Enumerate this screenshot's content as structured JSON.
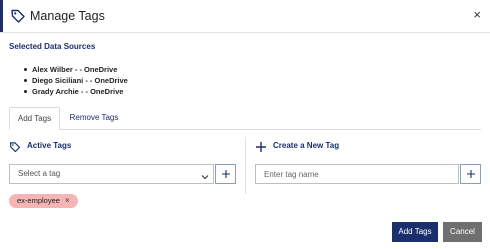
{
  "header": {
    "title": "Manage Tags",
    "close_label": "×"
  },
  "selected_sources": {
    "title": "Selected Data Sources",
    "items": [
      "Alex Wilber - - OneDrive",
      "Diego Siciliani - - OneDrive",
      "Grady Archie - - OneDrive"
    ]
  },
  "tabs": [
    {
      "label": "Add Tags",
      "active": true
    },
    {
      "label": "Remove Tags",
      "active": false
    }
  ],
  "active_tags": {
    "title": "Active Tags",
    "select_value": "Select a tag",
    "chips": [
      {
        "label": "ex-employee",
        "remove_label": "×"
      }
    ]
  },
  "new_tag": {
    "title": "Create a New Tag",
    "placeholder": "Enter tag name"
  },
  "footer": {
    "add_label": "Add Tags",
    "cancel_label": "Cancel"
  },
  "colors": {
    "accent": "#1b2f6e",
    "chip": "#f5b5b5",
    "cancel": "#6f6f6f"
  },
  "icons": {
    "header": "tag-icon",
    "active_tags": "tag-icon",
    "new_tag": "plus-icon"
  }
}
